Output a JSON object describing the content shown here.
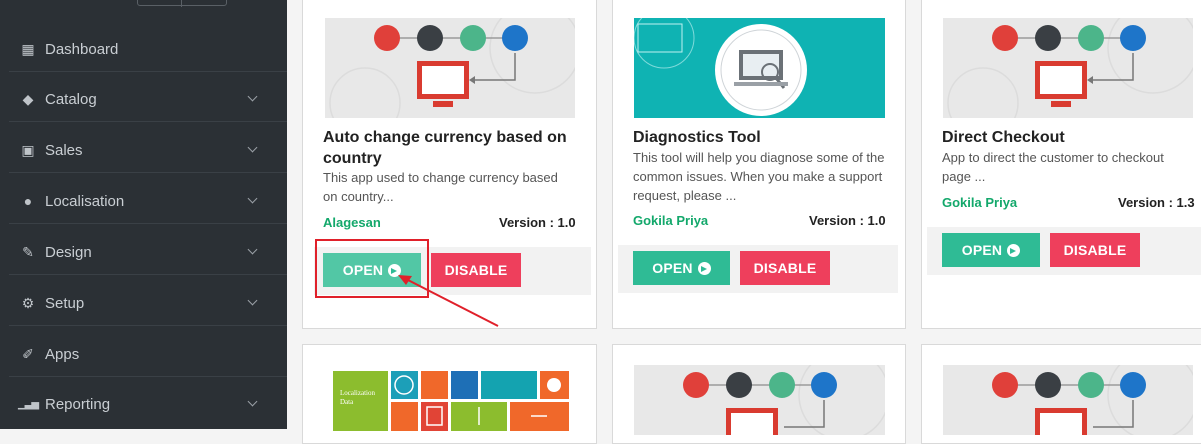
{
  "sidebar": {
    "items": [
      {
        "label": "Dashboard",
        "icon": "dashboard-icon",
        "glyph": "▦",
        "has_chevron": false
      },
      {
        "label": "Catalog",
        "icon": "tag-icon",
        "glyph": "◆",
        "has_chevron": true
      },
      {
        "label": "Sales",
        "icon": "money-icon",
        "glyph": "▣",
        "has_chevron": true
      },
      {
        "label": "Localisation",
        "icon": "globe-icon",
        "glyph": "●",
        "has_chevron": true
      },
      {
        "label": "Design",
        "icon": "brush-icon",
        "glyph": "✎",
        "has_chevron": true
      },
      {
        "label": "Setup",
        "icon": "cogs-icon",
        "glyph": "⚙",
        "has_chevron": true
      },
      {
        "label": "Apps",
        "icon": "wrench-icon",
        "glyph": "✐",
        "has_chevron": false
      },
      {
        "label": "Reporting",
        "icon": "bar-chart-icon",
        "glyph": "▁▃▅",
        "has_chevron": true
      }
    ]
  },
  "cards": [
    {
      "title_line1": "Auto change currency based on",
      "title_line2": "country",
      "desc_line1": "This app used to change currency based",
      "desc_line2": "on country...",
      "desc_line3": "",
      "author": "Alagesan",
      "version": "Version : 1.0",
      "open_label": "OPEN",
      "disable_label": "DISABLE"
    },
    {
      "title_line1": "Diagnostics Tool",
      "desc_line1": "This tool will help you diagnose some of the",
      "desc_line2": "common issues. When you make a support",
      "desc_line3": "request, please ...",
      "author": "Gokila Priya",
      "version": "Version : 1.0",
      "open_label": "OPEN",
      "disable_label": "DISABLE"
    },
    {
      "title_line1": "Direct Checkout",
      "desc_line1": "App to direct the customer to checkout",
      "desc_line2": "page ...",
      "author": "Gokila Priya",
      "version": "Version : 1.3",
      "open_label": "OPEN",
      "disable_label": "DISABLE"
    }
  ],
  "thumbs": {
    "localization_text_line1": "Localization",
    "localization_text_line2": "Data"
  },
  "colors": {
    "sidebar_bg": "#2b3035",
    "author_green": "#13a86b",
    "open_green": "#2fbb95",
    "disable_red": "#ee3f5c",
    "highlight_red": "#e0202a",
    "teal_thumb": "#0fb3b3"
  }
}
